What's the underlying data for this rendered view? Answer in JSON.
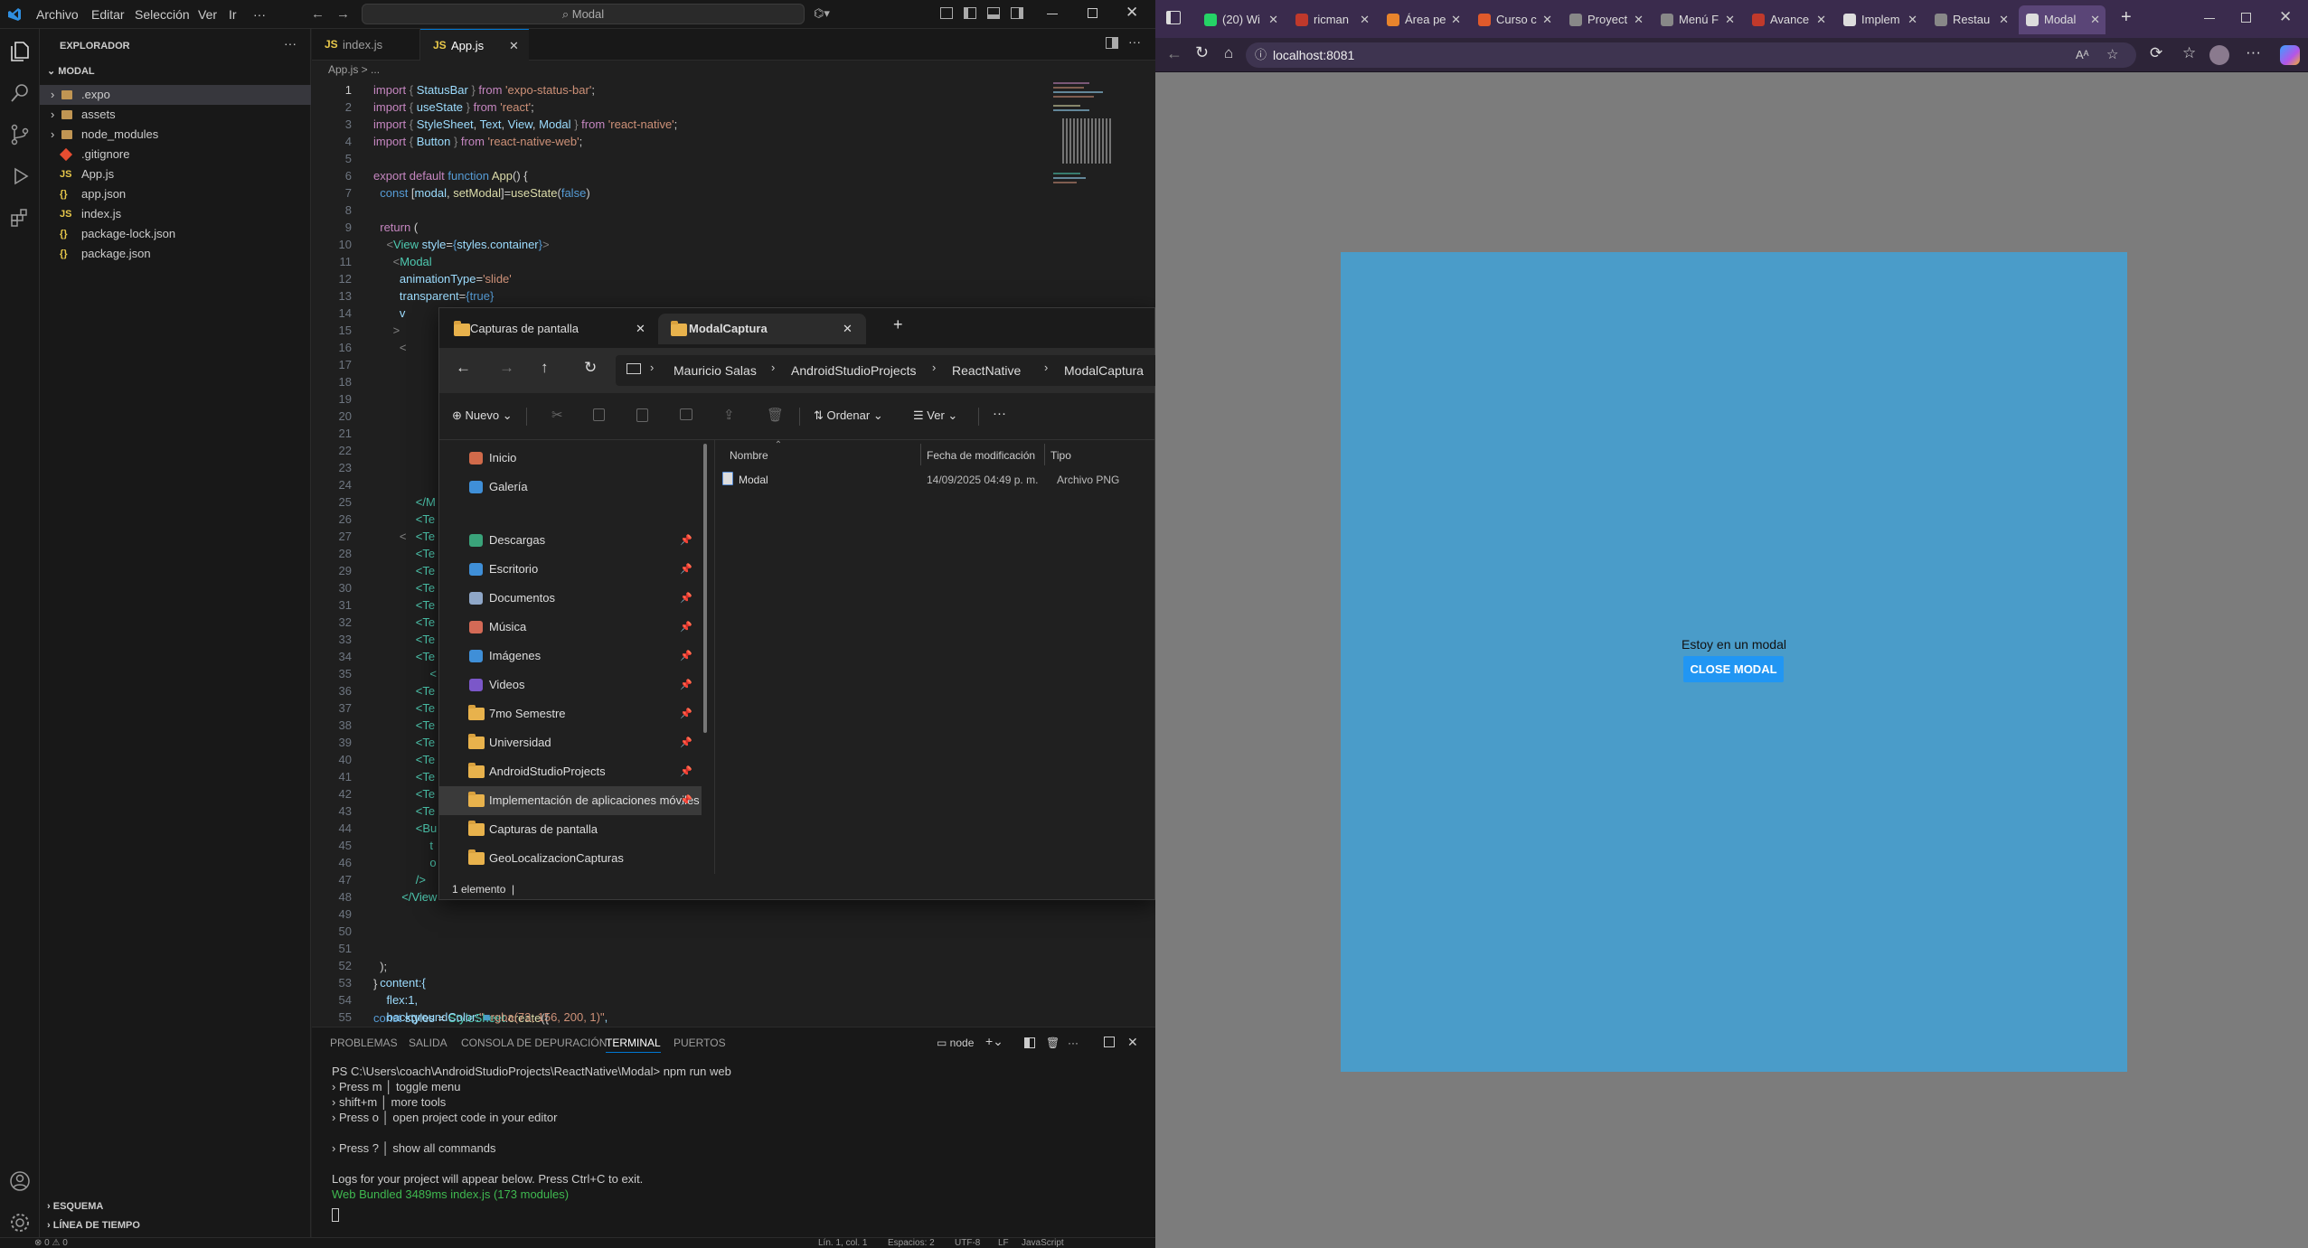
{
  "vscode": {
    "menu": [
      "Archivo",
      "Editar",
      "Selección",
      "Ver",
      "Ir",
      "···"
    ],
    "command_center": "Modal",
    "explorer_title": "EXPLORADOR",
    "explorer_more": "···",
    "project": "MODAL",
    "files": [
      {
        "name": ".expo",
        "type": "folder"
      },
      {
        "name": "assets",
        "type": "folder"
      },
      {
        "name": "node_modules",
        "type": "folder"
      },
      {
        "name": ".gitignore",
        "type": "git"
      },
      {
        "name": "App.js",
        "type": "js"
      },
      {
        "name": "app.json",
        "type": "json"
      },
      {
        "name": "index.js",
        "type": "js"
      },
      {
        "name": "package-lock.json",
        "type": "json"
      },
      {
        "name": "package.json",
        "type": "json"
      }
    ],
    "outline": "ESQUEMA",
    "timeline": "LÍNEA DE TIEMPO",
    "tabs": [
      "index.js",
      "App.js"
    ],
    "breadcrumb": "App.js > ...",
    "line_numbers": [
      "1",
      "2",
      "3",
      "4",
      "5",
      "6",
      "7",
      "8",
      "9",
      "10",
      "11",
      "12",
      "13",
      "14",
      "15",
      "16",
      "17",
      "18",
      "19",
      "20",
      "21",
      "22",
      "23",
      "24",
      "25",
      "26",
      "27",
      "28",
      "29",
      "30",
      "31",
      "32",
      "33",
      "34",
      "35",
      "36",
      "37",
      "38",
      "39",
      "40",
      "41",
      "42",
      "43",
      "44",
      "45",
      "46",
      "47",
      "48",
      "49",
      "50",
      "51",
      "52",
      "53",
      "54",
      "55"
    ],
    "code_fragments": [
      "</M",
      "<Te",
      "<Te",
      "<Te",
      "<Te",
      "<Te",
      "<Te",
      "<Te",
      "<Te",
      "<Te",
      "<",
      "<Te",
      "<Te",
      "<Te",
      "<Te",
      "<Te",
      "<Te",
      "<Te",
      "<Te",
      "<Bu",
      "t",
      "o",
      "/>",
      "</View"
    ],
    "panel_tabs": [
      "PROBLEMAS",
      "SALIDA",
      "CONSOLA DE DEPURACIÓN",
      "TERMINAL",
      "PUERTOS"
    ],
    "panel_node": "node",
    "terminal": [
      "PS C:\\Users\\coach\\AndroidStudioProjects\\ReactNative\\Modal> npm run web",
      "› Press m │ toggle menu",
      "› shift+m │ more tools",
      "› Press o │ open project code in your editor",
      "",
      "› Press ? │ show all commands",
      "",
      "Logs for your project will appear below. Press Ctrl+C to exit.",
      "Web Bundled 3489ms index.js (173 modules)"
    ],
    "status": [
      "Lín. 1, col. 1",
      "Espacios: 2",
      "UTF-8",
      "LF",
      "JavaScript"
    ],
    "status_left": "⊗ 0 ⚠ 0"
  },
  "explorer": {
    "tabs": [
      "Capturas de pantalla",
      "ModalCaptura"
    ],
    "path": [
      "Mauricio Salas",
      "AndroidStudioProjects",
      "ReactNative",
      "ModalCaptura"
    ],
    "new_label": "Nuevo",
    "sort_label": "Ordenar",
    "view_label": "Ver",
    "nav": [
      "Inicio",
      "Galería",
      "Descargas",
      "Escritorio",
      "Documentos",
      "Música",
      "Imágenes",
      "Videos",
      "7mo Semestre",
      "Universidad",
      "AndroidStudioProjects",
      "Implementación de aplicaciones móviles",
      "Capturas de pantalla",
      "GeoLocalizacionCapturas"
    ],
    "columns": [
      "Nombre",
      "Fecha de modificación",
      "Tipo"
    ],
    "file": {
      "name": "Modal",
      "date": "14/09/2025 04:49 p. m.",
      "type": "Archivo PNG"
    },
    "status": "1 elemento"
  },
  "browser": {
    "tabs": [
      "(20) Wi",
      "ricman",
      "Área pe",
      "Curso c",
      "Proyect",
      "Menú F",
      "Avance",
      "Implem",
      "Restau",
      "Modal"
    ],
    "url": "localhost:8081",
    "modal_text": "Estoy en un modal",
    "modal_button": "CLOSE MODAL",
    "accent": "#4a9cc9",
    "button_color": "#2196f3"
  }
}
